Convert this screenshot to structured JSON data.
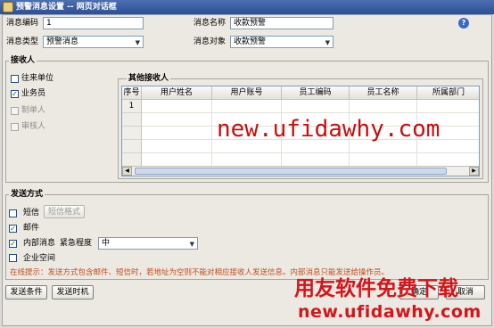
{
  "window": {
    "title": "预警消息设置 -- 网页对话框"
  },
  "form": {
    "msg_code_label": "消息编码",
    "msg_code_value": "1",
    "msg_name_label": "消息名称",
    "msg_name_value": "收款预警",
    "msg_type_label": "消息类型",
    "msg_type_value": "预警消息",
    "msg_object_label": "消息对象",
    "msg_object_value": "收款预警"
  },
  "receivers": {
    "title": "接收人",
    "options": [
      {
        "label": "往来单位",
        "checked": false,
        "disabled": false
      },
      {
        "label": "业务员",
        "checked": true,
        "disabled": false
      },
      {
        "label": "制单人",
        "checked": false,
        "disabled": true
      },
      {
        "label": "审核人",
        "checked": false,
        "disabled": true
      }
    ]
  },
  "other_receivers": {
    "title": "其他接收人",
    "columns": [
      "序号",
      "用户姓名",
      "用户账号",
      "员工编码",
      "员工名称",
      "所属部门"
    ],
    "rows": [
      "1",
      "",
      "",
      "",
      "",
      "",
      "",
      "",
      ""
    ]
  },
  "send_method": {
    "title": "发送方式",
    "sms_label": "短信",
    "sms_checked": false,
    "sms_format_button": "短信格式",
    "mail_label": "邮件",
    "mail_checked": true,
    "internal_label": "内部消息",
    "internal_checked": true,
    "urgency_label": "紧急程度",
    "urgency_value": "中",
    "enterprise_label": "企业空间",
    "enterprise_checked": false,
    "tip": "在线提示：发送方式包含邮件、短信时，若地址为空则不能对相应接收人发送信息。内部消息只能发送给操作员。"
  },
  "buttons": {
    "send_condition": "发送条件",
    "send_timing": "发送时机",
    "ok": "确定",
    "cancel": "取消"
  },
  "watermark": {
    "center": "new.ufidawhy.com",
    "brand": "用友软件免费下载",
    "bottom": "new.ufidawhy.com"
  },
  "colors": {
    "title_bar": "#2c4f96",
    "tip_text": "#c24a1d",
    "watermark": "#c80e0e"
  }
}
